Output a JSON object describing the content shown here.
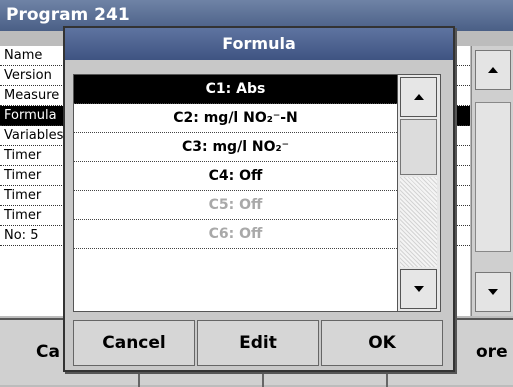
{
  "background": {
    "title": "Program 241",
    "rows": [
      "Name",
      "Version",
      "Measure",
      "Formula",
      "Variables",
      "Timer",
      "Timer",
      "Timer",
      "Timer",
      "No: 5"
    ],
    "selected_row": 3,
    "bottom_left_label": "Ca",
    "bottom_right_label": "ore"
  },
  "dialog": {
    "title": "Formula",
    "items": [
      {
        "label": "C1: Abs",
        "state": "selected"
      },
      {
        "label": "C2: mg/l NO₂⁻-N",
        "state": "normal"
      },
      {
        "label": "C3: mg/l NO₂⁻",
        "state": "normal"
      },
      {
        "label": "C4: Off",
        "state": "normal"
      },
      {
        "label": "C5: Off",
        "state": "disabled"
      },
      {
        "label": "C6: Off",
        "state": "disabled"
      }
    ],
    "scroll_up_icon": "arrow-up-icon",
    "scroll_down_icon": "arrow-down-icon",
    "buttons": {
      "cancel": "Cancel",
      "edit": "Edit",
      "ok": "OK"
    }
  }
}
